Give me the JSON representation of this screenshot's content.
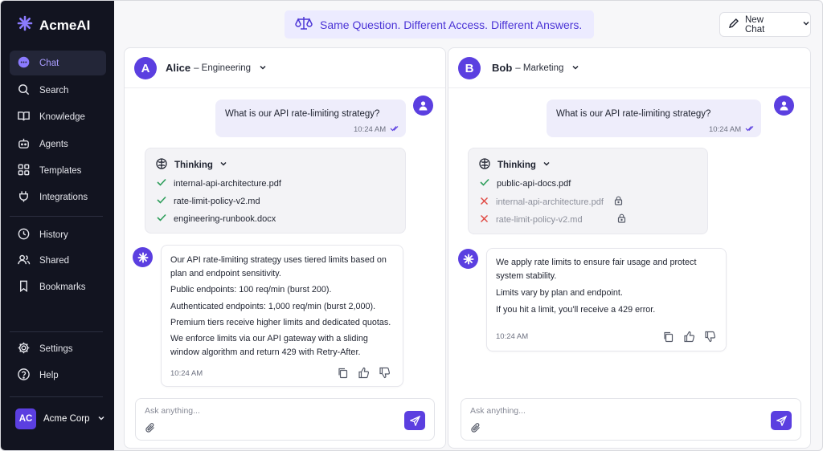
{
  "app": {
    "name": "AcmeAI"
  },
  "sidebar": {
    "nav": [
      {
        "label": "Chat",
        "icon": "chat-bubble-icon",
        "active": true
      },
      {
        "label": "Search",
        "icon": "search-icon"
      },
      {
        "label": "Knowledge",
        "icon": "book-icon"
      },
      {
        "label": "Agents",
        "icon": "robot-icon"
      },
      {
        "label": "Templates",
        "icon": "grid-icon"
      },
      {
        "label": "Integrations",
        "icon": "plug-icon"
      }
    ],
    "secondary": [
      {
        "label": "History",
        "icon": "clock-icon"
      },
      {
        "label": "Shared",
        "icon": "users-icon"
      },
      {
        "label": "Bookmarks",
        "icon": "bookmark-icon"
      }
    ],
    "bottom": [
      {
        "label": "Settings",
        "icon": "gear-icon"
      },
      {
        "label": "Help",
        "icon": "help-circle-icon"
      }
    ],
    "workspace": {
      "initials": "AC",
      "name": "Acme Corp"
    }
  },
  "header": {
    "banner": "Same Question. Different Access. Different Answers.",
    "new_chat_label": "New Chat"
  },
  "panels": [
    {
      "user": {
        "initial": "A",
        "name": "Alice",
        "role": "– Engineering"
      },
      "question": "What is our API rate-limiting strategy?",
      "question_time": "10:24 AM",
      "thinking_label": "Thinking",
      "docs": [
        {
          "name": "internal-api-architecture.pdf",
          "status": "allowed"
        },
        {
          "name": "rate-limit-policy-v2.md",
          "status": "allowed"
        },
        {
          "name": "engineering-runbook.docx",
          "status": "allowed"
        }
      ],
      "answer_lines": [
        "Our API rate-limiting strategy uses tiered limits based on",
        "plan and endpoint sensitivity.",
        "Public endpoints: 100 req/min (burst 200).",
        "Authenticated endpoints: 1,000 req/min (burst 2,000).",
        "Premium tiers receive higher limits and dedicated quotas.",
        "We enforce limits via our API gateway with a sliding",
        "window algorithm and return 429 with Retry-After."
      ],
      "answer_time": "10:24 AM",
      "input_placeholder": "Ask anything..."
    },
    {
      "user": {
        "initial": "B",
        "name": "Bob",
        "role": "– Marketing"
      },
      "question": "What is our API rate-limiting strategy?",
      "question_time": "10:24 AM",
      "thinking_label": "Thinking",
      "docs": [
        {
          "name": "public-api-docs.pdf",
          "status": "allowed"
        },
        {
          "name": "internal-api-architecture.pdf",
          "status": "denied"
        },
        {
          "name": "rate-limit-policy-v2.md",
          "status": "denied"
        }
      ],
      "answer_lines": [
        "We apply rate limits to ensure fair usage and protect",
        "system stability.",
        "Limits vary by plan and endpoint.",
        "If you hit a limit, you'll receive a 429 error."
      ],
      "answer_time": "10:24 AM",
      "input_placeholder": "Ask anything..."
    }
  ],
  "colors": {
    "accent": "#5b3fe0",
    "sidebar_bg": "#121420",
    "allowed": "#2e9e5b",
    "denied": "#e0453f"
  }
}
